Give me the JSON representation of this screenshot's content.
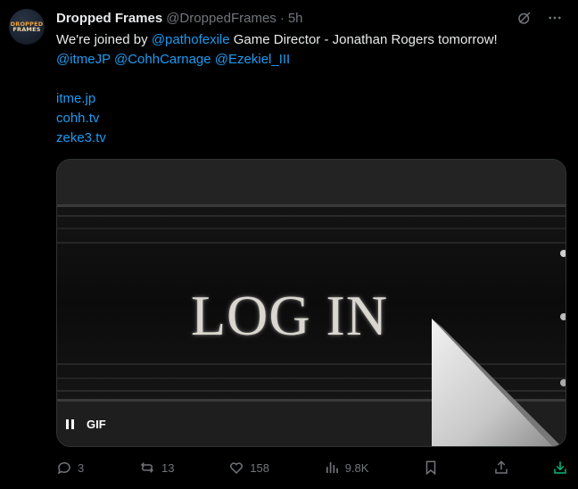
{
  "tweet": {
    "author_name": "Dropped Frames",
    "author_handle": "@DroppedFrames",
    "separator": "·",
    "time": "5h",
    "avatar_text_line1": "DROPPED",
    "avatar_text_line2": "FRAMES",
    "text_intro": "We're joined by ",
    "mention_pathofexile": "@pathofexile",
    "text_rest": " Game Director - Jonathan Rogers tomorrow!",
    "mention_itmejp": "@itmeJP",
    "mention_cohh": "@CohhCarnage",
    "mention_ezekiel": "@Ezekiel_III",
    "link_itme": "itme.jp",
    "link_cohh": "cohh.tv",
    "link_zeke": "zeke3.tv"
  },
  "media": {
    "overlay_text": "LOG IN",
    "gif_label": "GIF"
  },
  "actions": {
    "replies": "3",
    "reposts": "13",
    "likes": "158",
    "views": "9.8K"
  },
  "colors": {
    "link": "#1d9bf0",
    "muted": "#71767b",
    "text": "#e7e9ea",
    "download": "#00ba7c"
  }
}
